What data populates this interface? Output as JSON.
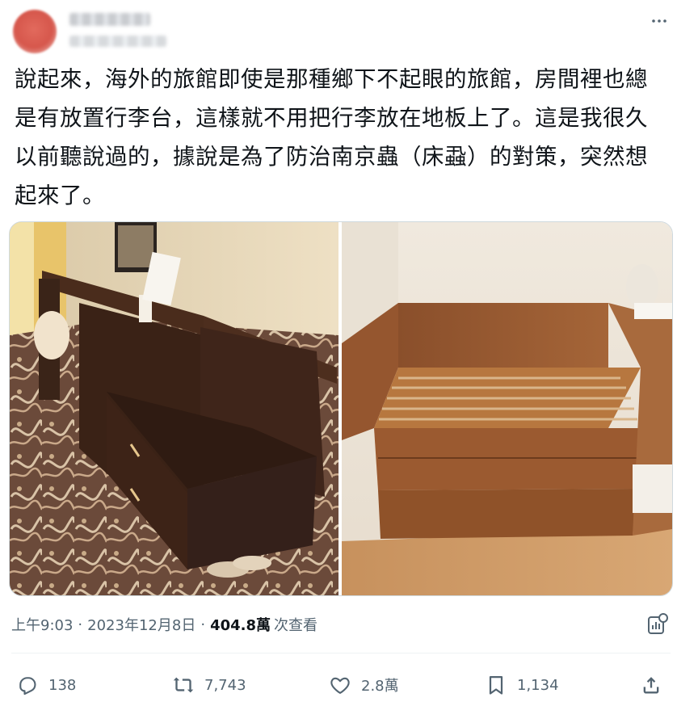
{
  "post": {
    "text": "說起來，海外的旅館即使是那種鄉下不起眼的旅館，房間裡也總是有放置行李台，這樣就不用把行李放在地板上了。這是我很久以前聽說過的，據說是為了防治南京蟲（床蝨）的對策，突然想起來了。",
    "time": "上午9:03",
    "date": "2023年12月8日",
    "views_count": "404.8萬",
    "views_label": "次查看"
  },
  "actions": {
    "replies": "138",
    "reposts": "7,743",
    "likes": "2.8萬",
    "bookmarks": "1,134"
  },
  "icons": {
    "more": "more-dots-icon",
    "analytics": "analytics-icon",
    "reply": "reply-icon",
    "repost": "repost-icon",
    "like": "heart-icon",
    "bookmark": "bookmark-icon",
    "share": "share-icon"
  },
  "colors": {
    "text": "#0f1419",
    "secondary": "#536471",
    "border": "#cfd9de"
  }
}
